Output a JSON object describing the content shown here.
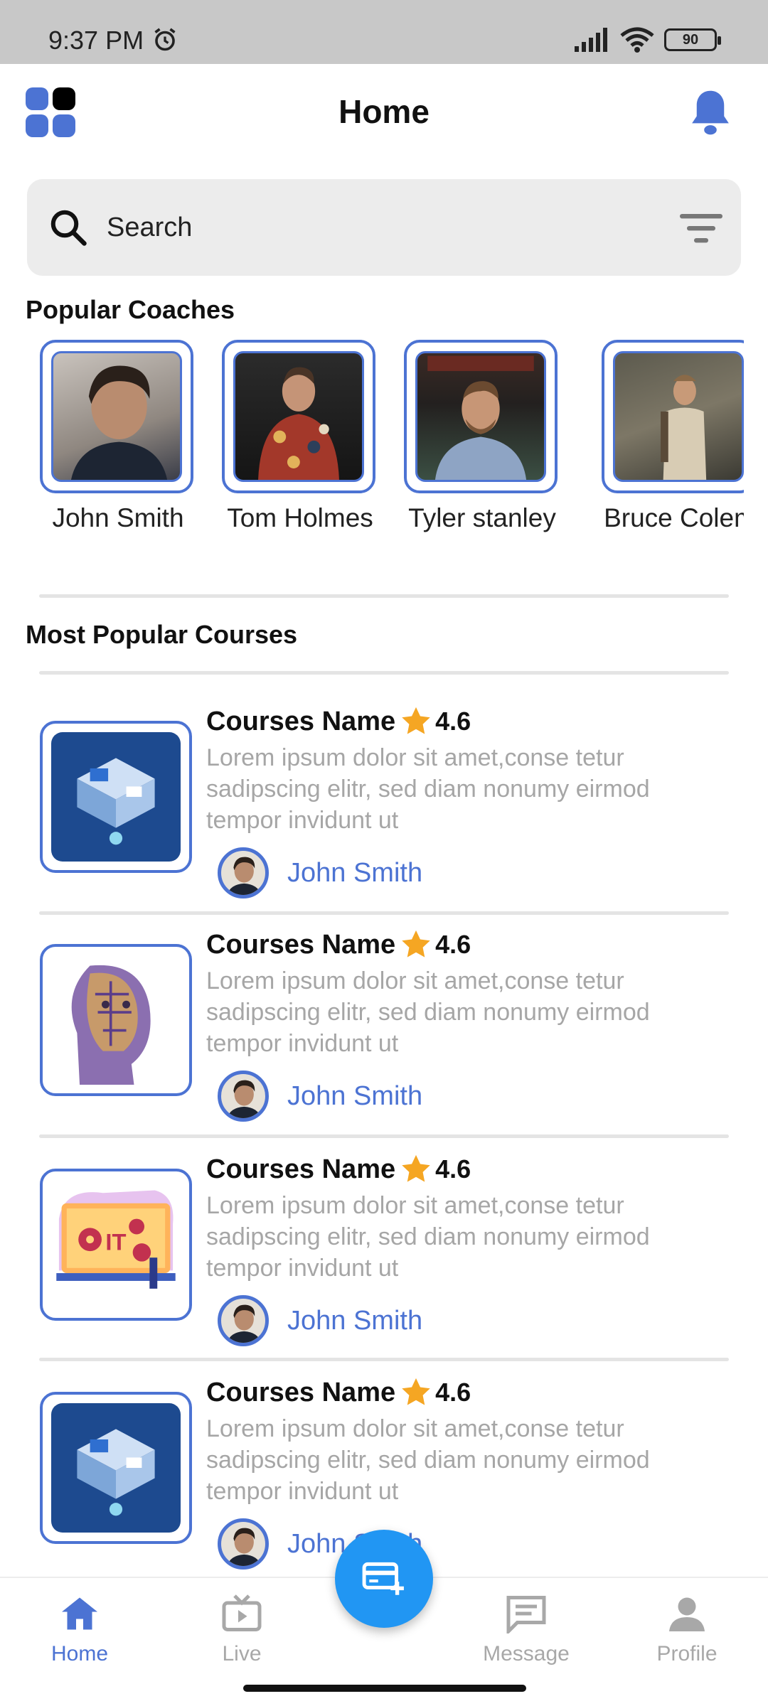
{
  "status_bar": {
    "time": "9:37 PM",
    "battery": "90"
  },
  "header": {
    "title": "Home"
  },
  "search": {
    "placeholder": "Search"
  },
  "coaches_section": {
    "title": "Popular Coaches",
    "coaches": [
      {
        "name": "John Smith"
      },
      {
        "name": "Tom Holmes"
      },
      {
        "name": "Tyler stanley"
      },
      {
        "name": "Bruce Colem"
      }
    ]
  },
  "courses_section": {
    "title": "Most Popular Courses",
    "courses": [
      {
        "name": "Courses Name",
        "rating": "4.6",
        "description": "Lorem ipsum dolor sit amet,conse tetur\nsadipscing elitr, sed diam nonumy eirmod\n tempor invidunt ut",
        "author": "John Smith",
        "thumbnail": "isometric-workspace-illustration"
      },
      {
        "name": "Courses Name",
        "rating": "4.6",
        "description": "Lorem ipsum dolor sit amet,conse tetur\nsadipscing elitr, sed diam nonumy eirmod\n tempor invidunt ut",
        "author": "John Smith",
        "thumbnail": "ai-circuit-face-illustration"
      },
      {
        "name": "Courses Name",
        "rating": "4.6",
        "description": "Lorem ipsum dolor sit amet,conse tetur\nsadipscing elitr, sed diam nonumy eirmod\n tempor invidunt ut",
        "author": "John Smith",
        "thumbnail": "it-gears-illustration"
      },
      {
        "name": "Courses Name",
        "rating": "4.6",
        "description": "Lorem ipsum dolor sit amet,conse tetur\nsadipscing elitr, sed diam nonumy eirmod\n tempor invidunt ut",
        "author": "John Smith",
        "thumbnail": "isometric-workspace-illustration"
      }
    ]
  },
  "bottom_nav": {
    "items": [
      {
        "label": "Home",
        "icon": "home-icon",
        "active": true
      },
      {
        "label": "Live",
        "icon": "tv-icon",
        "active": false
      },
      {
        "label": "Message",
        "icon": "message-icon",
        "active": false
      },
      {
        "label": "Profile",
        "icon": "person-icon",
        "active": false
      }
    ],
    "fab_icon": "add-card-icon"
  },
  "colors": {
    "accent": "#4c73d3",
    "fab": "#2196f3",
    "star": "#f5a623",
    "muted_text": "#a6a6a6"
  }
}
